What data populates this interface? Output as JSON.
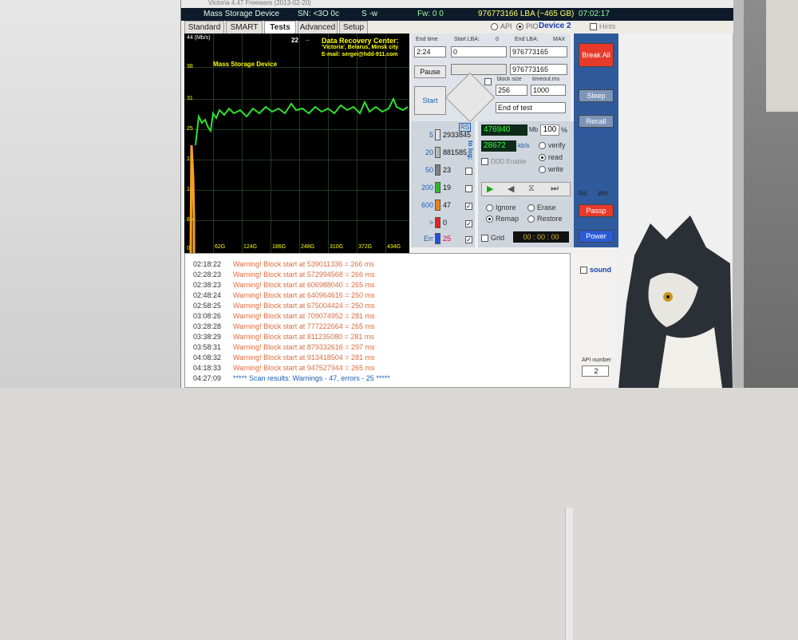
{
  "window_title": "Victoria 4.47 Freeware (2013-02-20)",
  "infobar": {
    "device": "Mass Storage Device",
    "sn": "SN: <3O 0c",
    "s": "S -w",
    "fw": "Fw: 0 0",
    "lba": "976773166 LBA (~465 GB)",
    "clock": "07:02:17"
  },
  "tabs": [
    "Standard",
    "SMART",
    "Tests",
    "Advanced",
    "Setup"
  ],
  "top_right": {
    "api": "API",
    "pio": "PIO",
    "device": "Device 2",
    "hints": "Hints"
  },
  "graph": {
    "header": "44 (Mb/s)",
    "value": "22",
    "y_labels": [
      "38",
      "31",
      "25",
      "19",
      "12",
      "6,4",
      "0"
    ],
    "x_labels": [
      "62G",
      "124G",
      "186G",
      "248G",
      "310G",
      "372G",
      "434G"
    ],
    "device_label": "Mass Storage Device",
    "credit_1": "Data Recovery Center:",
    "credit_2": "'Victoria', Belarus, Minsk city",
    "credit_3": "E-mail: sergei@hdd-911.com"
  },
  "controls": {
    "end_time_label": "End time",
    "start_lba_label": "Start LBA:",
    "start_lba_small": "0",
    "end_lba_label": "End LBA:",
    "max": "MAX",
    "time_value": "2:24",
    "start_lba": "0",
    "end_lba": "976773165",
    "end_lba_2": "976773165",
    "pause": "Pause",
    "start": "Start",
    "block_size_label": "block size",
    "block_size": "256",
    "timeout_label": "timeout.ms",
    "timeout": "1000",
    "end_of_test": "End of test"
  },
  "blocks": [
    {
      "ms": "5",
      "count": "2933845",
      "color": "#e0e0e0"
    },
    {
      "ms": "20",
      "count": "881585",
      "color": "#b8b8b8"
    },
    {
      "ms": "50",
      "count": "23",
      "color": "#808080"
    },
    {
      "ms": "200",
      "count": "19",
      "color": "#2db82d"
    },
    {
      "ms": "600",
      "count": "47",
      "color": "#f08020"
    },
    {
      "ms": ">",
      "count": "0",
      "color": "#e82020"
    },
    {
      "ms": "Err",
      "count": "25",
      "color": "#2050e0"
    }
  ],
  "rs": "RS",
  "to_log": "to log:",
  "stats": {
    "mb": "476940",
    "mb_unit": "Mb",
    "pct": "100",
    "pct_unit": "%",
    "speed": "28672",
    "speed_unit": "kb/s",
    "ddd": "DDD Enable",
    "verify": "verify",
    "read": "read",
    "write": "write",
    "ignore": "Ignore",
    "erase": "Erase",
    "remap": "Remap",
    "restore": "Restore",
    "grid": "Grid",
    "timer": "00 : 00 : 00"
  },
  "side": {
    "break_all": "Break All",
    "sleep": "Sleep",
    "recall": "Recall",
    "rd": "Rd",
    "wrt": "Wrt",
    "passp": "Passp",
    "power": "Power",
    "sound": "sound",
    "api_number_label": "API number",
    "api_number": "2"
  },
  "log": [
    {
      "t": "02:18:22",
      "m": "Warning! Block start at 539011336 = 266 ms"
    },
    {
      "t": "02:28:23",
      "m": "Warning! Block start at 572994568 = 266 ms"
    },
    {
      "t": "02:38:23",
      "m": "Warning! Block start at 606988040 = 265 ms"
    },
    {
      "t": "02:48:24",
      "m": "Warning! Block start at 640964616 = 250 ms"
    },
    {
      "t": "02:58:25",
      "m": "Warning! Block start at 675004424 = 250 ms"
    },
    {
      "t": "03:08:26",
      "m": "Warning! Block start at 709074952 = 281 ms"
    },
    {
      "t": "03:28:28",
      "m": "Warning! Block start at 777222664 = 265 ms"
    },
    {
      "t": "03:38:29",
      "m": "Warning! Block start at 811235080 = 281 ms"
    },
    {
      "t": "03:58:31",
      "m": "Warning! Block start at 879332616 = 297 ms"
    },
    {
      "t": "04:08:32",
      "m": "Warning! Block start at 913418504 = 281 ms"
    },
    {
      "t": "04:18:33",
      "m": "Warning! Block start at 947527944 = 265 ms"
    },
    {
      "t": "04:27:09",
      "m": "***** Scan results: Warnings - 47, errors - 25 *****"
    }
  ]
}
